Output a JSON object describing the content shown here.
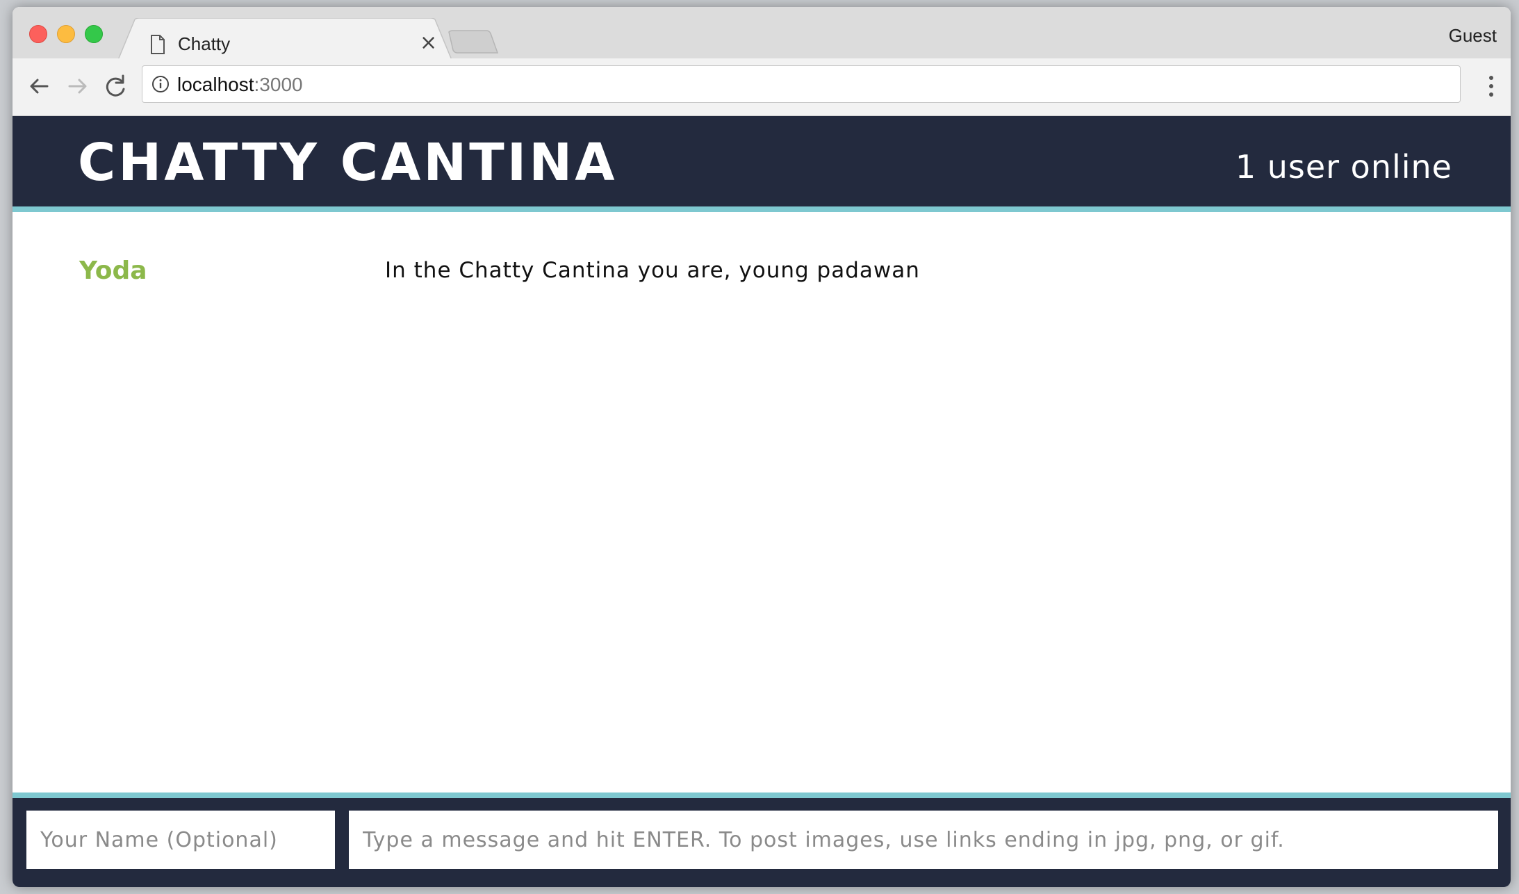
{
  "browser": {
    "tab_title": "Chatty",
    "profile_label": "Guest",
    "url_host": "localhost",
    "url_port": ":3000",
    "icons": [
      "document-icon",
      "close-icon",
      "back-arrow-icon",
      "forward-arrow-icon",
      "reload-icon",
      "info-icon",
      "kebab-menu-icon"
    ]
  },
  "app": {
    "title": "CHATTY CANTINA",
    "users_online": "1 user online",
    "colors": {
      "header_bg": "#232a3e",
      "accent_border": "#7ec8d0",
      "username_color": "#8cb84a"
    }
  },
  "messages": [
    {
      "username": "Yoda",
      "content": "In the Chatty Cantina you are, young padawan"
    }
  ],
  "composer": {
    "name_placeholder": "Your Name (Optional)",
    "message_placeholder": "Type a message and hit ENTER. To post images, use links ending in jpg, png, or gif."
  }
}
